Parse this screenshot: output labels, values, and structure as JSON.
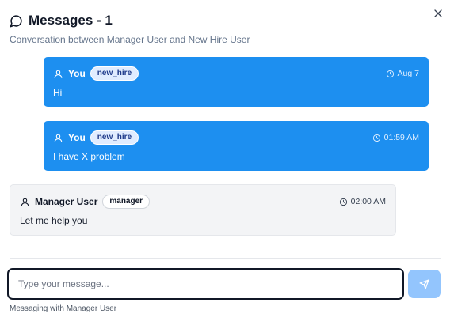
{
  "dialog": {
    "title": "Messages - 1",
    "subtitle": "Conversation between Manager User and New Hire User"
  },
  "messages": [
    {
      "sender": "You",
      "role": "new_hire",
      "time": "Aug 7",
      "text": "Hi",
      "side": "mine"
    },
    {
      "sender": "You",
      "role": "new_hire",
      "time": "01:59 AM",
      "text": "I have X problem",
      "side": "mine"
    },
    {
      "sender": "Manager User",
      "role": "manager",
      "time": "02:00 AM",
      "text": "Let me help you",
      "side": "theirs"
    }
  ],
  "composer": {
    "placeholder": "Type your message...",
    "value": ""
  },
  "footer": {
    "note": "Messaging with Manager User"
  },
  "icons": {
    "title": "message-circle-icon",
    "close": "close-icon",
    "user": "user-icon",
    "clock": "clock-icon",
    "send": "send-icon"
  },
  "colors": {
    "own_bubble": "#1d8ff0",
    "other_bubble": "#f3f4f6",
    "send_button": "#93c5fd"
  }
}
